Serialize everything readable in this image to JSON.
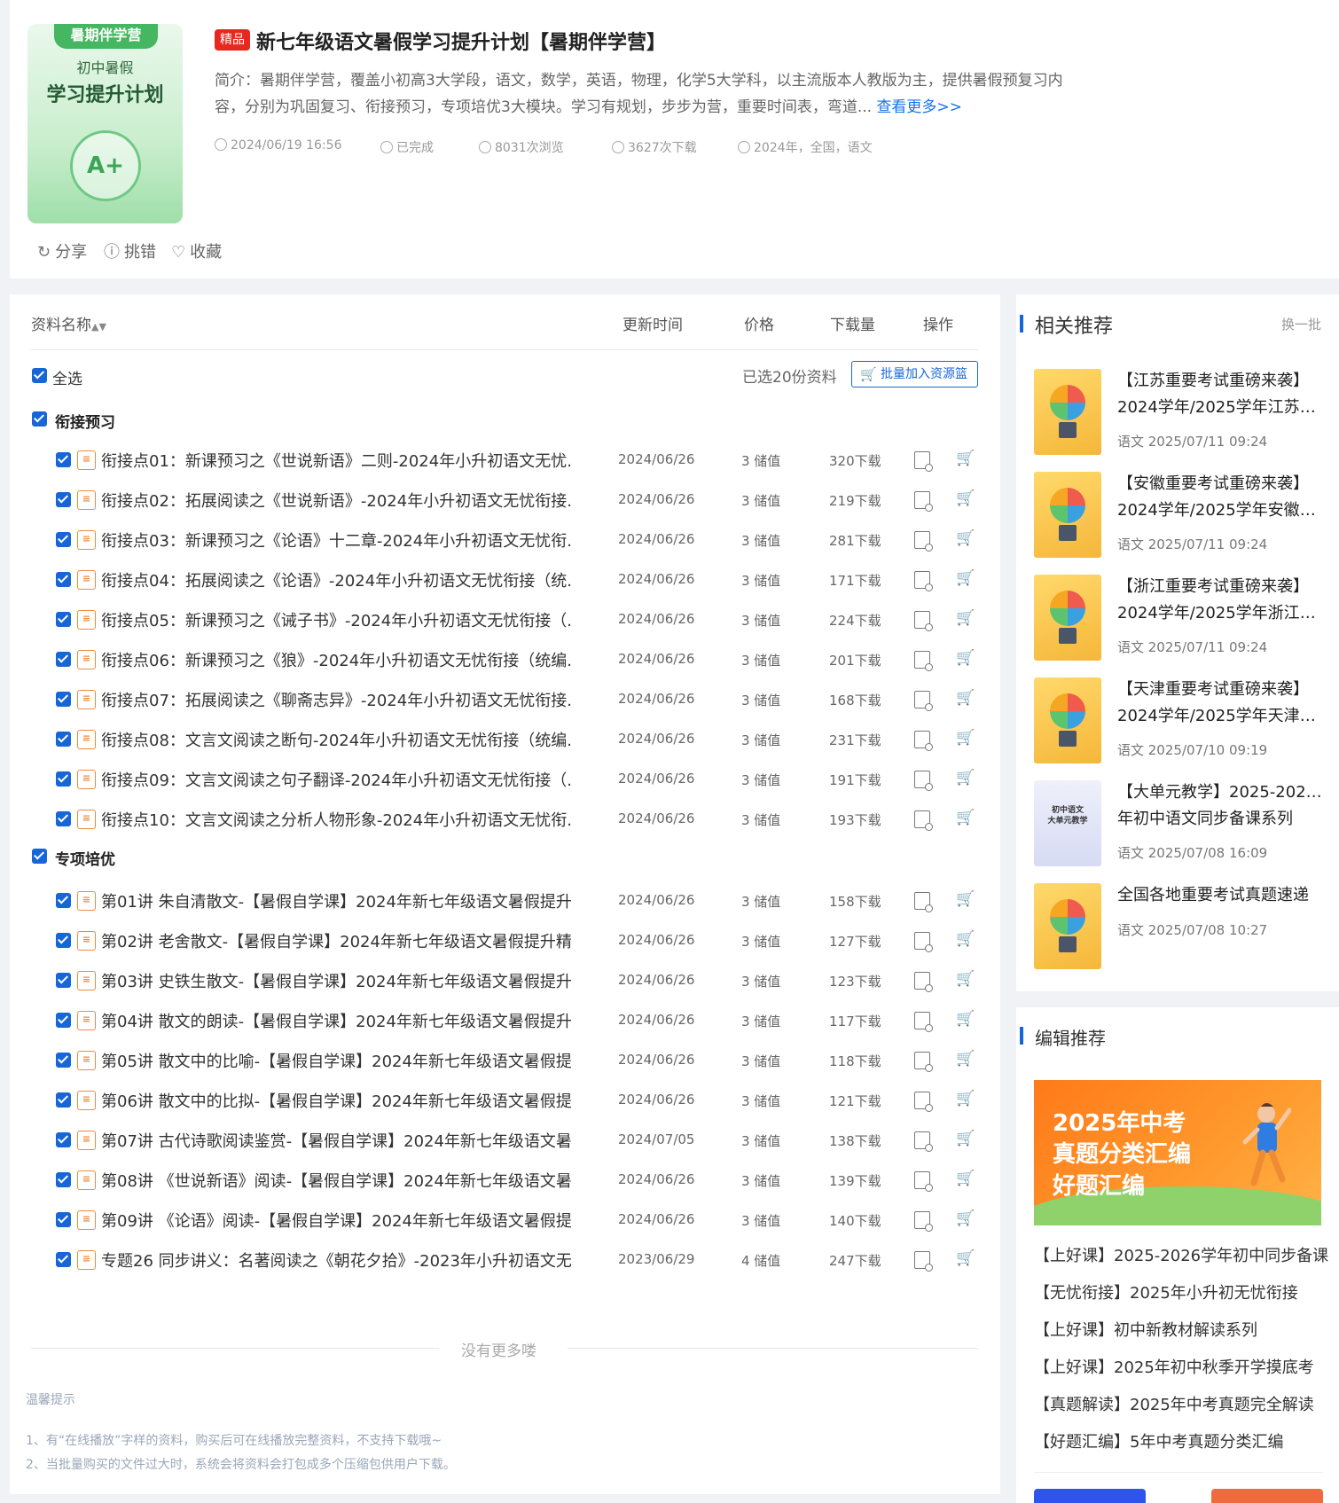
{
  "cover": {
    "ribbon": "暑期伴学营",
    "line1": "初中暑假",
    "line2": "学习提升计划",
    "emblem": "A+"
  },
  "header": {
    "badge": "精品",
    "title": "新七年级语文暑假学习提升计划【暑期伴学营】",
    "intro": "简介：暑期伴学营，覆盖小初高3大学段，语文，数学，英语，物理，化学5大学科，以主流版本人教版为主，提供暑假预复习内容，分别为巩固复习、衔接预习，专项培优3大模块。学习有规划，步步为营，重要时间表，弯道...",
    "more": "查看更多>>",
    "meta": {
      "date": "2024/06/19 16:56",
      "status": "已完成",
      "views": "8031次浏览",
      "downloads": "3627次下载",
      "tags": "2024年，全国，语文"
    },
    "actions": {
      "share": "分享",
      "report": "挑错",
      "favorite": "收藏"
    }
  },
  "table": {
    "col_name": "资料名称",
    "col_time": "更新时间",
    "col_price": "价格",
    "col_dl": "下载量",
    "col_op": "操作",
    "select_all": "全选",
    "selected_count": "已选20份资料",
    "batch_button": "批量加入资源篮"
  },
  "sections": [
    {
      "title": "衔接预习",
      "items": [
        {
          "name": "衔接点01：新课预习之《世说新语》二则-2024年小升初语文无忧...",
          "date": "2024/06/26",
          "price": "3 储值",
          "dl": "320下载"
        },
        {
          "name": "衔接点02：拓展阅读之《世说新语》-2024年小升初语文无忧衔接...",
          "date": "2024/06/26",
          "price": "3 储值",
          "dl": "219下载"
        },
        {
          "name": "衔接点03：新课预习之《论语》十二章-2024年小升初语文无忧衔...",
          "date": "2024/06/26",
          "price": "3 储值",
          "dl": "281下载"
        },
        {
          "name": "衔接点04：拓展阅读之《论语》-2024年小升初语文无忧衔接（统...",
          "date": "2024/06/26",
          "price": "3 储值",
          "dl": "171下载"
        },
        {
          "name": "衔接点05：新课预习之《诫子书》-2024年小升初语文无忧衔接（...",
          "date": "2024/06/26",
          "price": "3 储值",
          "dl": "224下载"
        },
        {
          "name": "衔接点06：新课预习之《狼》-2024年小升初语文无忧衔接（统编...",
          "date": "2024/06/26",
          "price": "3 储值",
          "dl": "201下载"
        },
        {
          "name": "衔接点07：拓展阅读之《聊斋志异》-2024年小升初语文无忧衔接...",
          "date": "2024/06/26",
          "price": "3 储值",
          "dl": "168下载"
        },
        {
          "name": "衔接点08：文言文阅读之断句-2024年小升初语文无忧衔接（统编...",
          "date": "2024/06/26",
          "price": "3 储值",
          "dl": "231下载"
        },
        {
          "name": "衔接点09：文言文阅读之句子翻译-2024年小升初语文无忧衔接（...",
          "date": "2024/06/26",
          "price": "3 储值",
          "dl": "191下载"
        },
        {
          "name": "衔接点10：文言文阅读之分析人物形象-2024年小升初语文无忧衔...",
          "date": "2024/06/26",
          "price": "3 储值",
          "dl": "193下载"
        }
      ]
    },
    {
      "title": "专项培优",
      "items": [
        {
          "name": "第01讲 朱自清散文-【暑假自学课】2024年新七年级语文暑假提升...",
          "date": "2024/06/26",
          "price": "3 储值",
          "dl": "158下载"
        },
        {
          "name": "第02讲 老舍散文-【暑假自学课】2024年新七年级语文暑假提升精...",
          "date": "2024/06/26",
          "price": "3 储值",
          "dl": "127下载"
        },
        {
          "name": "第03讲 史铁生散文-【暑假自学课】2024年新七年级语文暑假提升...",
          "date": "2024/06/26",
          "price": "3 储值",
          "dl": "123下载"
        },
        {
          "name": "第04讲 散文的朗读-【暑假自学课】2024年新七年级语文暑假提升...",
          "date": "2024/06/26",
          "price": "3 储值",
          "dl": "117下载"
        },
        {
          "name": "第05讲 散文中的比喻-【暑假自学课】2024年新七年级语文暑假提...",
          "date": "2024/06/26",
          "price": "3 储值",
          "dl": "118下载"
        },
        {
          "name": "第06讲 散文中的比拟-【暑假自学课】2024年新七年级语文暑假提...",
          "date": "2024/06/26",
          "price": "3 储值",
          "dl": "121下载"
        },
        {
          "name": "第07讲 古代诗歌阅读鉴赏-【暑假自学课】2024年新七年级语文暑...",
          "date": "2024/07/05",
          "price": "3 储值",
          "dl": "138下载"
        },
        {
          "name": "第08讲 《世说新语》阅读-【暑假自学课】2024年新七年级语文暑...",
          "date": "2024/06/26",
          "price": "3 储值",
          "dl": "139下载"
        },
        {
          "name": "第09讲 《论语》阅读-【暑假自学课】2024年新七年级语文暑假提...",
          "date": "2024/06/26",
          "price": "3 储值",
          "dl": "140下载"
        },
        {
          "name": "专题26 同步讲义：名著阅读之《朝花夕拾》-2023年小升初语文无...",
          "date": "2023/06/29",
          "price": "4 储值",
          "dl": "247下载"
        }
      ]
    }
  ],
  "footer": {
    "no_more": "没有更多喽",
    "tips_title": "温馨提示",
    "tip1": "1、有“在线播放”字样的资料，购买后可在线播放完整资料，不支持下载哦~",
    "tip2": "2、当批量购买的文件过大时，系统会将资料会打包成多个压缩包供用户下载。"
  },
  "related": {
    "title": "相关推荐",
    "refresh": "换一批",
    "items": [
      {
        "line1": "【江苏重要考试重磅来袭】",
        "line2": "2024学年/2025学年江苏省...",
        "meta": "语文 2025/07/11 09:24",
        "thumb": "bulb"
      },
      {
        "line1": "【安徽重要考试重磅来袭】",
        "line2": "2024学年/2025学年安徽省...",
        "meta": "语文 2025/07/11 09:24",
        "thumb": "bulb"
      },
      {
        "line1": "【浙江重要考试重磅来袭】",
        "line2": "2024学年/2025学年浙江省...",
        "meta": "语文 2025/07/11 09:24",
        "thumb": "bulb"
      },
      {
        "line1": "【天津重要考试重磅来袭】",
        "line2": "2024学年/2025学年天津市...",
        "meta": "语文 2025/07/10 09:19",
        "thumb": "bulb"
      },
      {
        "line1": "【大单元教学】2025-2026学",
        "line2": "年初中语文同步备课系列",
        "meta": "语文 2025/07/08 16:09",
        "thumb": "book",
        "thumb_text": "初中语文\n大单元教学"
      },
      {
        "line1": "全国各地重要考试真题速递",
        "line2": "",
        "meta": "语文 2025/07/08 10:27",
        "thumb": "bulb"
      }
    ]
  },
  "editor": {
    "title": "编辑推荐",
    "banner": {
      "l1": "2025年中考",
      "l2": "真题分类汇编",
      "l3": "好题汇编"
    },
    "links": [
      "【上好课】2025-2026学年初中同步备课",
      "【无忧衔接】2025年小升初无忧衔接",
      "【上好课】初中新教材解读系列",
      "【上好课】2025年初中秋季开学摸底考",
      "【真题解读】2025年中考真题完全解读",
      "【好题汇编】5年中考真题分类汇编"
    ]
  }
}
